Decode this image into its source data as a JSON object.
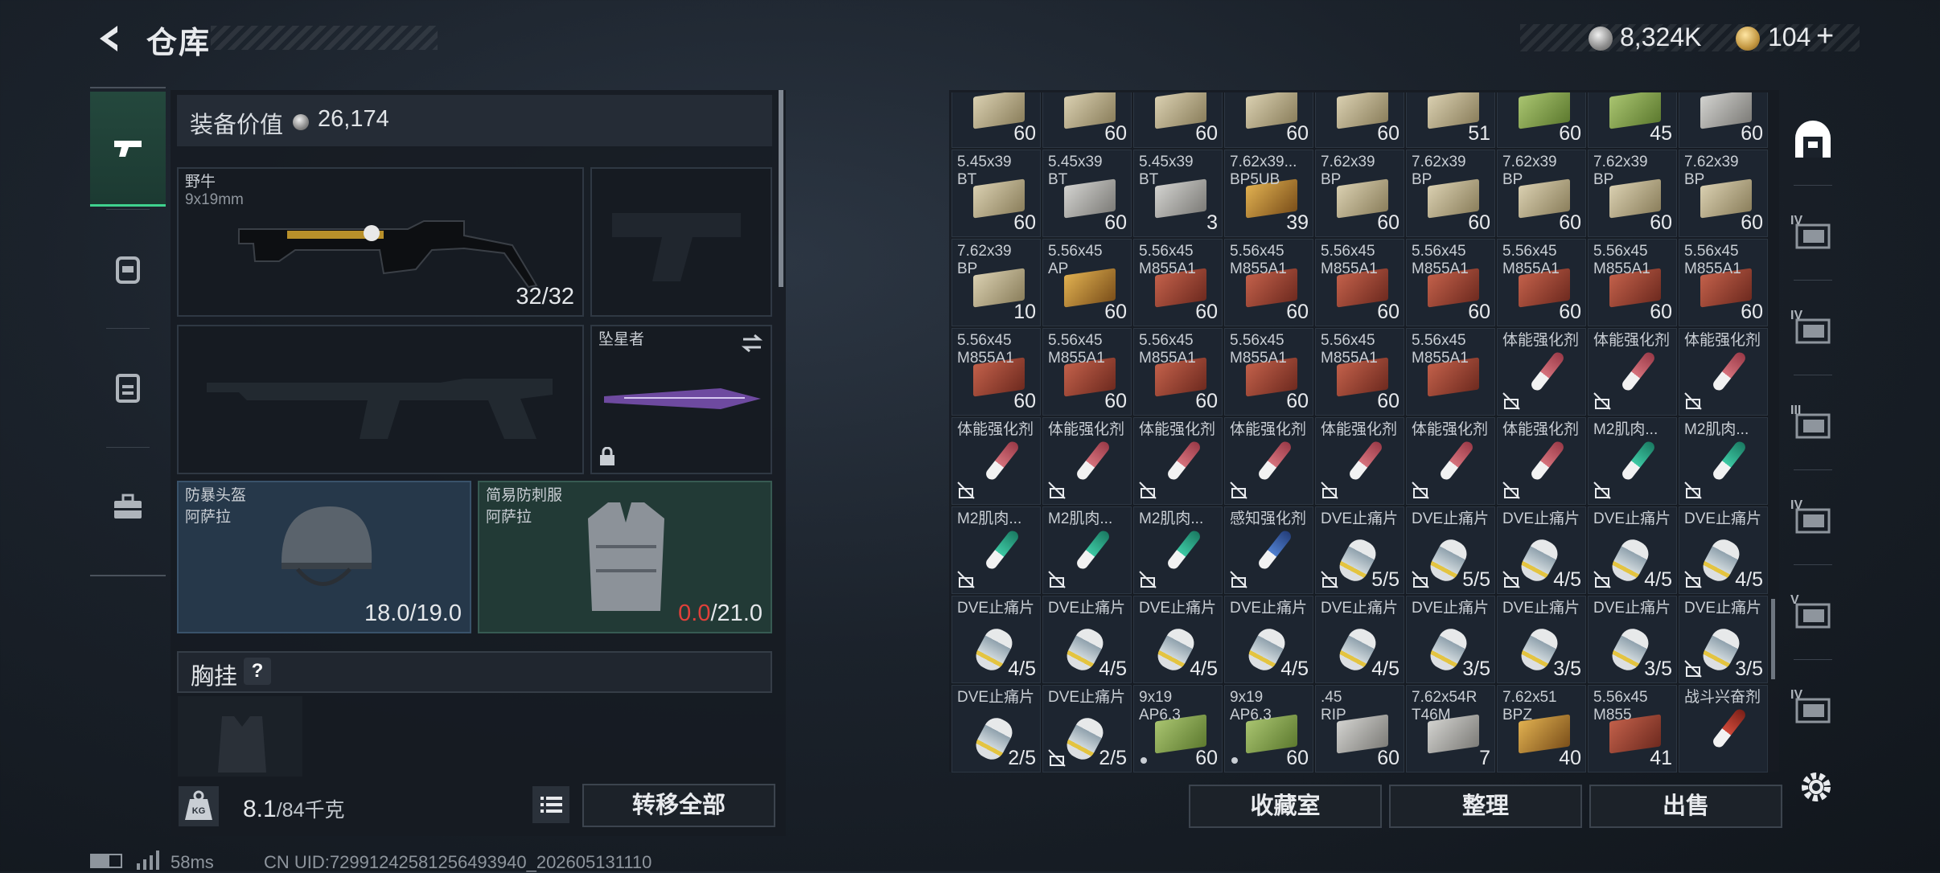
{
  "header": {
    "title": "仓库",
    "back_icon": "back-arrow-icon"
  },
  "currency": {
    "silver": "8,324K",
    "gold": "104",
    "plus": "+"
  },
  "left_nav": [
    {
      "name": "weapons",
      "icon": "pistol-icon",
      "active": true
    },
    {
      "name": "armor",
      "icon": "backpack-icon",
      "active": false
    },
    {
      "name": "clipboard",
      "icon": "clipboard-icon",
      "active": false
    },
    {
      "name": "toolbox",
      "icon": "toolbox-icon",
      "active": false
    }
  ],
  "equipment": {
    "value_label": "装备价值",
    "value": "26,174",
    "primary": {
      "name": "野牛",
      "caliber": "9x19mm",
      "ammo": "32/32"
    },
    "melee": {
      "name": "坠星者",
      "locked": true
    },
    "helmet": {
      "name": "防暴头盔",
      "sub": "阿萨拉",
      "durability": "18.0/19.0"
    },
    "armor": {
      "name": "简易防刺服",
      "sub": "阿萨拉",
      "dur_current": "0.0",
      "dur_max": "/21.0"
    },
    "chest_label": "胸挂",
    "chest_help": "?"
  },
  "capacity": {
    "value": "8.1",
    "unit": "/84千克",
    "transfer_label": "转移全部"
  },
  "inventory": {
    "cells": [
      {
        "name": "",
        "count": "60",
        "kind": "box",
        "color": "beige"
      },
      {
        "name": "",
        "count": "60",
        "kind": "box",
        "color": "beige"
      },
      {
        "name": "",
        "count": "60",
        "kind": "box",
        "color": "beige"
      },
      {
        "name": "",
        "count": "60",
        "kind": "box",
        "color": "beige"
      },
      {
        "name": "",
        "count": "60",
        "kind": "box",
        "color": "beige"
      },
      {
        "name": "",
        "count": "51",
        "kind": "box",
        "color": "beige"
      },
      {
        "name": "",
        "count": "60",
        "kind": "box",
        "color": "green"
      },
      {
        "name": "",
        "count": "45",
        "kind": "box",
        "color": "green"
      },
      {
        "name": "",
        "count": "60",
        "kind": "box",
        "color": "grey"
      },
      {
        "name": "5.45x39\nBT",
        "count": "60",
        "kind": "box",
        "color": "beige"
      },
      {
        "name": "5.45x39\nBT",
        "count": "60",
        "kind": "box",
        "color": "grey"
      },
      {
        "name": "5.45x39\nBT",
        "count": "3",
        "kind": "box",
        "color": "grey"
      },
      {
        "name": "7.62x39...\nBP5UB",
        "count": "39",
        "kind": "box",
        "color": "gold"
      },
      {
        "name": "7.62x39\nBP",
        "count": "60",
        "kind": "box",
        "color": "beige"
      },
      {
        "name": "7.62x39\nBP",
        "count": "60",
        "kind": "box",
        "color": "beige"
      },
      {
        "name": "7.62x39\nBP",
        "count": "60",
        "kind": "box",
        "color": "beige"
      },
      {
        "name": "7.62x39\nBP",
        "count": "60",
        "kind": "box",
        "color": "beige"
      },
      {
        "name": "7.62x39\nBP",
        "count": "60",
        "kind": "box",
        "color": "beige"
      },
      {
        "name": "7.62x39\nBP",
        "count": "10",
        "kind": "box",
        "color": "beige"
      },
      {
        "name": "5.56x45\nAP",
        "count": "60",
        "kind": "box",
        "color": "gold"
      },
      {
        "name": "5.56x45\nM855A1",
        "count": "60",
        "kind": "box",
        "color": "red"
      },
      {
        "name": "5.56x45\nM855A1",
        "count": "60",
        "kind": "box",
        "color": "red"
      },
      {
        "name": "5.56x45\nM855A1",
        "count": "60",
        "kind": "box",
        "color": "red"
      },
      {
        "name": "5.56x45\nM855A1",
        "count": "60",
        "kind": "box",
        "color": "red"
      },
      {
        "name": "5.56x45\nM855A1",
        "count": "60",
        "kind": "box",
        "color": "red"
      },
      {
        "name": "5.56x45\nM855A1",
        "count": "60",
        "kind": "box",
        "color": "red"
      },
      {
        "name": "5.56x45\nM855A1",
        "count": "60",
        "kind": "box",
        "color": "red"
      },
      {
        "name": "5.56x45\nM855A1",
        "count": "60",
        "kind": "box",
        "color": "red"
      },
      {
        "name": "5.56x45\nM855A1",
        "count": "60",
        "kind": "box",
        "color": "red"
      },
      {
        "name": "5.56x45\nM855A1",
        "count": "60",
        "kind": "box",
        "color": "red"
      },
      {
        "name": "5.56x45\nM855A1",
        "count": "60",
        "kind": "box",
        "color": "red"
      },
      {
        "name": "5.56x45\nM855A1",
        "count": "60",
        "kind": "box",
        "color": "red"
      },
      {
        "name": "5.56x45\nM855A1",
        "count": "",
        "kind": "box",
        "color": "red"
      },
      {
        "name": "体能强化剂",
        "count": "",
        "kind": "syringe",
        "color": "pink",
        "locked": true
      },
      {
        "name": "体能强化剂",
        "count": "",
        "kind": "syringe",
        "color": "pink",
        "locked": true
      },
      {
        "name": "体能强化剂",
        "count": "",
        "kind": "syringe",
        "color": "pink",
        "locked": true
      },
      {
        "name": "体能强化剂",
        "count": "",
        "kind": "syringe",
        "color": "pink",
        "locked": true
      },
      {
        "name": "体能强化剂",
        "count": "",
        "kind": "syringe",
        "color": "pink",
        "locked": true
      },
      {
        "name": "体能强化剂",
        "count": "",
        "kind": "syringe",
        "color": "pink",
        "locked": true
      },
      {
        "name": "体能强化剂",
        "count": "",
        "kind": "syringe",
        "color": "pink",
        "locked": true
      },
      {
        "name": "体能强化剂",
        "count": "",
        "kind": "syringe",
        "color": "pink",
        "locked": true
      },
      {
        "name": "体能强化剂",
        "count": "",
        "kind": "syringe",
        "color": "pink",
        "locked": true
      },
      {
        "name": "体能强化剂",
        "count": "",
        "kind": "syringe",
        "color": "pink",
        "locked": true
      },
      {
        "name": "M2肌肉...",
        "count": "",
        "kind": "syringe",
        "color": "teal",
        "locked": true
      },
      {
        "name": "M2肌肉...",
        "count": "",
        "kind": "syringe",
        "color": "teal",
        "locked": true
      },
      {
        "name": "M2肌肉...",
        "count": "",
        "kind": "syringe",
        "color": "teal",
        "locked": true
      },
      {
        "name": "M2肌肉...",
        "count": "",
        "kind": "syringe",
        "color": "teal",
        "locked": true
      },
      {
        "name": "M2肌肉...",
        "count": "",
        "kind": "syringe",
        "color": "teal",
        "locked": true
      },
      {
        "name": "感知强化剂",
        "count": "",
        "kind": "syringe",
        "color": "blue",
        "locked": true
      },
      {
        "name": "DVE止痛片",
        "count": "5/5",
        "kind": "pill",
        "color": "",
        "locked": true
      },
      {
        "name": "DVE止痛片",
        "count": "5/5",
        "kind": "pill",
        "color": "",
        "locked": true
      },
      {
        "name": "DVE止痛片",
        "count": "4/5",
        "kind": "pill",
        "color": "",
        "locked": true
      },
      {
        "name": "DVE止痛片",
        "count": "4/5",
        "kind": "pill",
        "color": "",
        "locked": true
      },
      {
        "name": "DVE止痛片",
        "count": "4/5",
        "kind": "pill",
        "color": "",
        "locked": true
      },
      {
        "name": "DVE止痛片",
        "count": "4/5",
        "kind": "pill",
        "color": ""
      },
      {
        "name": "DVE止痛片",
        "count": "4/5",
        "kind": "pill",
        "color": ""
      },
      {
        "name": "DVE止痛片",
        "count": "4/5",
        "kind": "pill",
        "color": ""
      },
      {
        "name": "DVE止痛片",
        "count": "4/5",
        "kind": "pill",
        "color": ""
      },
      {
        "name": "DVE止痛片",
        "count": "4/5",
        "kind": "pill",
        "color": ""
      },
      {
        "name": "DVE止痛片",
        "count": "3/5",
        "kind": "pill",
        "color": ""
      },
      {
        "name": "DVE止痛片",
        "count": "3/5",
        "kind": "pill",
        "color": ""
      },
      {
        "name": "DVE止痛片",
        "count": "3/5",
        "kind": "pill",
        "color": ""
      },
      {
        "name": "DVE止痛片",
        "count": "3/5",
        "kind": "pill",
        "color": "",
        "locked": true
      },
      {
        "name": "DVE止痛片",
        "count": "2/5",
        "kind": "pill",
        "color": ""
      },
      {
        "name": "DVE止痛片",
        "count": "2/5",
        "kind": "pill",
        "color": "",
        "locked": true
      },
      {
        "name": "9x19\nAP6.3",
        "count": "60",
        "kind": "box",
        "color": "green",
        "dot": true
      },
      {
        "name": "9x19\nAP6.3",
        "count": "60",
        "kind": "box",
        "color": "green",
        "dot": true
      },
      {
        "name": ".45\nRIP",
        "count": "60",
        "kind": "box",
        "color": "grey"
      },
      {
        "name": "7.62x54R\nT46M",
        "count": "7",
        "kind": "box",
        "color": "grey"
      },
      {
        "name": "7.62x51\nBPZ",
        "count": "40",
        "kind": "box",
        "color": "gold"
      },
      {
        "name": "5.56x45\nM855",
        "count": "41",
        "kind": "box",
        "color": "red"
      },
      {
        "name": "战斗兴奋剂",
        "count": "",
        "kind": "syringe",
        "color": "red2"
      }
    ]
  },
  "right_nav": [
    {
      "icon": "storage-door-icon",
      "label": ""
    },
    {
      "icon": "folder-icon",
      "label": "IV"
    },
    {
      "icon": "folder-icon",
      "label": "IV"
    },
    {
      "icon": "weapon-case-icon",
      "label": "III"
    },
    {
      "icon": "medkit-case-icon",
      "label": "IV"
    },
    {
      "icon": "safe-case-icon",
      "label": "V"
    },
    {
      "icon": "tool-case-icon",
      "label": "IV"
    }
  ],
  "actions": {
    "collection": "收藏室",
    "sort": "整理",
    "sell": "出售"
  },
  "status": {
    "ping": "58ms",
    "uid": "CN UID:7299124258125649394​0_202605131110"
  }
}
